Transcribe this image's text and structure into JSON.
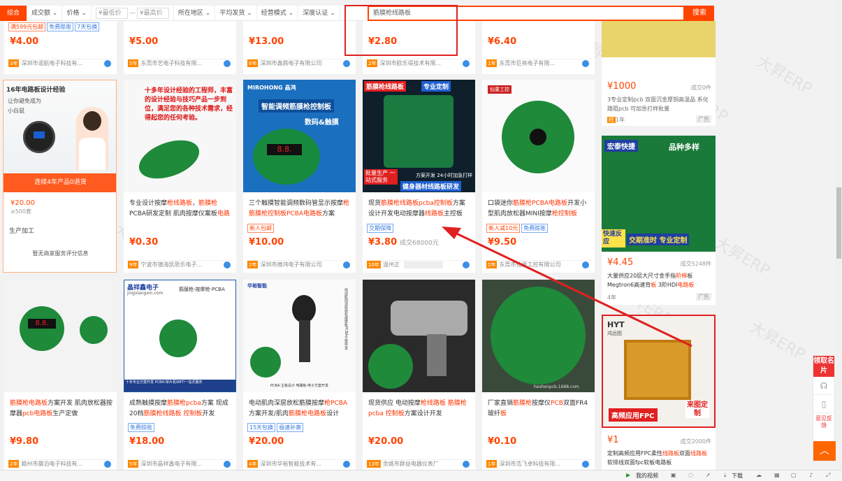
{
  "topbar": {
    "tab_active": "综合",
    "sort_items": [
      "成交额",
      "价格"
    ],
    "price_min_placeholder": "¥最低价",
    "price_sep": "—",
    "price_max_placeholder": "¥最高价",
    "filters": [
      "所在地区",
      "平均发货",
      "经营模式",
      "深度认证"
    ],
    "search_value": "筋膜枪线路板",
    "search_button": "搜索"
  },
  "row1": [
    {
      "price": "¥4.00",
      "tags": [
        "满599元包邮",
        "免费赊账",
        "7天包换"
      ],
      "years": "3年",
      "shop": "深圳市诺航电子科技有..."
    },
    {
      "price": "¥5.00",
      "years": "5年",
      "shop": "东莞市艺电子科技有限..."
    },
    {
      "price": "¥13.00",
      "years": "6年",
      "shop": "深圳市鑫鼎电子有限公司"
    },
    {
      "price": "¥2.80",
      "years": "2年",
      "shop": "深圳市欧乐得技术有限..."
    },
    {
      "price": "¥6.40",
      "years": "1年",
      "shop": "东莞市巨亮电子有限..."
    }
  ],
  "seller_card": {
    "banner_top": "16年电路板设计经验",
    "banner_line2": "让你避免成为",
    "banner_line3": "小白鼠",
    "banner_bottom": "连续4年产品0退货",
    "price": "¥20.00",
    "moq": "≥500套",
    "label": "生产加工",
    "service": "暂无商家服务评分信息"
  },
  "row2": [
    {
      "img_text": "十多年设计经验的工程师，丰富的设计经验与技巧产品一步到位，满足您的各种技术需求，经得起您的任何考验。",
      "title_parts": [
        "专业设计按摩",
        "枪线路板",
        "，",
        "筋膜枪",
        "PCBA研发定制 肌肉按摩仪案板",
        "电路"
      ],
      "price": "¥0.30",
      "years": "9年",
      "shop": "宁波市镇海凯思乐电子..."
    },
    {
      "img_brand": "MIROHONG 晶鸿",
      "img_header": "智能调频筋膜枪控制板",
      "img_badge": "数码&触摸",
      "title_parts": [
        "三个触摸智能调频数码管显示按摩",
        "枪",
        "筋膜枪控制板PCBA电路板",
        "方案"
      ],
      "tags": [
        "新人包邮"
      ],
      "price": "¥10.00",
      "years": "2年",
      "shop": "深圳市微鸿电子有限公司"
    },
    {
      "img_header": "筋膜枪线路板",
      "img_header2": "专业定制",
      "img_footer1": "批量生产 一站式服务",
      "img_footer2": "健身器材线路板研发",
      "img_note": "方案开发 24小时加急打样",
      "title_parts": [
        "现货",
        "筋膜枪线路板pcba控制板",
        "方案设计开发电动按摩器",
        "线路板",
        "主控板"
      ],
      "tags": [
        "交期保障"
      ],
      "price": "¥3.80",
      "sold": "成交68000元",
      "years": "10年",
      "shop": "温州正"
    },
    {
      "img_brand": "仙童工控",
      "title_parts": [
        "口袋迷你",
        "筋膜枪PCBA电路板",
        "开发小型肌肉放松器MINI按摩",
        "枪控制板"
      ],
      "tags": [
        "新人减10元",
        "免费赊账"
      ],
      "price": "¥9.50",
      "years": "2年",
      "shop": "东莞市仙童工控有限公司"
    }
  ],
  "col6": [
    {
      "price": "¥1000",
      "sold": "成交0件",
      "title": "3专业定制pcb 双面沉金厚铜高温品 系化路阻pcb 可加急打样批量",
      "years": "1年",
      "ad": "广告"
    },
    {
      "img_top": "宏泰快捷",
      "img_top2": "品种多样",
      "img_bottom1": "快速反应",
      "img_bottom2": "交期准时 专业定制",
      "price": "¥4.45",
      "sold": "成交5248件",
      "title_parts": [
        "大量供应20层大尺寸金手指",
        "阶梯",
        "板 Megtron6高速背",
        "板",
        " 3阶HDI",
        "电路板"
      ],
      "years": "4年",
      "ad": "广告"
    },
    {
      "img_brand": "HYT",
      "img_brand2": "鸿远图",
      "img_footer": "高频应用FPC",
      "img_footer2": "来图定制",
      "price": "¥1",
      "sold": "成交2000件",
      "title_parts": [
        "定制高频应用FPC柔性",
        "线路板",
        "双面",
        "线路板",
        "软排线双面fpc软板电路板"
      ]
    }
  ],
  "row3": [
    {
      "title_parts": [
        "筋膜枪电路板",
        "方案开发 肌肉放松器按摩器",
        "pcb电路板",
        "生产定做"
      ],
      "price": "¥9.80",
      "years": "2年",
      "shop": "赣州市晨泊电子科技有..."
    },
    {
      "img_brand": "晶祥鑫电子",
      "img_sub": "jingxiangxin.com",
      "img_tag": "筋膜枪-按摩枪-PCBA",
      "img_footer": "十年专业方案开发 PCBA!单片机SMT!一站式服务",
      "title_parts": [
        "成熟触摸按摩",
        "筋膜枪pcba",
        "方案 现成20档",
        "筋膜枪线路板 控制板",
        "开发"
      ],
      "tags": [
        "免费赊账"
      ],
      "price": "¥18.00",
      "years": "5年",
      "shop": "深圳市晶祥鑫电子有限..."
    },
    {
      "img_brand": "华裕智能",
      "img_side": "电动肌肉深层放松按摩枪PCBA方案开发",
      "img_footer": "PCBA·主板设计·电路板·电子方案开发",
      "title_parts": [
        "电动肌肉深层放松筋膜按摩",
        "枪PCBA",
        "方案开发/肌肉",
        "筋膜枪电路板",
        "设计"
      ],
      "tags": [
        "15天包换",
        "极速补寄"
      ],
      "price": "¥20.00",
      "years": "4年",
      "shop": "深圳市华裕智能技术有..."
    },
    {
      "title_parts": [
        "现货供应 电动按摩",
        "枪线路板 筋膜枪pcba 控制板",
        "方案设计开发"
      ],
      "price": "¥20.00",
      "years": "13年",
      "shop": "余姚市群益电器仪表厂"
    },
    {
      "img_site": "heshenpcb.1688.com",
      "title_parts": [
        "厂家直销",
        "筋膜枪",
        "按摩仪",
        "PCB",
        "双面FR4玻纤",
        "板"
      ],
      "price": "¥0.10",
      "years": "1年",
      "shop": "深圳市浩飞卓科技有限..."
    }
  ],
  "right_tools": {
    "get_card": "领取名片",
    "feedback": "意见反馈"
  },
  "bottombar": {
    "video": "我的视频",
    "download": "下载"
  },
  "watermark_text": "大昇ERP",
  "colors": {
    "accent": "#ff4400",
    "highlight": "#ff3300",
    "annotation": "#e02020"
  }
}
